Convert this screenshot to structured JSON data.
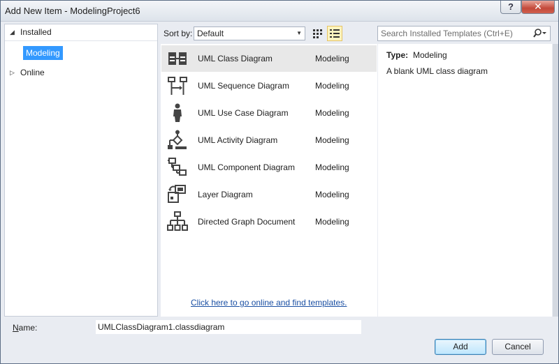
{
  "window": {
    "title": "Add New Item - ModelingProject6",
    "help_label": "?",
    "close_label": "✕"
  },
  "tree": {
    "installed_label": "Installed",
    "selected_child": "Modeling",
    "online_label": "Online"
  },
  "toolbar": {
    "sort_label": "Sort by:",
    "sort_value": "Default",
    "search_placeholder": "Search Installed Templates (Ctrl+E)"
  },
  "templates": [
    {
      "name": "UML Class Diagram",
      "category": "Modeling",
      "icon": "class-diagram-icon"
    },
    {
      "name": "UML Sequence Diagram",
      "category": "Modeling",
      "icon": "sequence-diagram-icon"
    },
    {
      "name": "UML Use Case Diagram",
      "category": "Modeling",
      "icon": "use-case-diagram-icon"
    },
    {
      "name": "UML Activity Diagram",
      "category": "Modeling",
      "icon": "activity-diagram-icon"
    },
    {
      "name": "UML Component Diagram",
      "category": "Modeling",
      "icon": "component-diagram-icon"
    },
    {
      "name": "Layer Diagram",
      "category": "Modeling",
      "icon": "layer-diagram-icon"
    },
    {
      "name": "Directed Graph Document",
      "category": "Modeling",
      "icon": "directed-graph-icon"
    }
  ],
  "online_link": "Click here to go online and find templates.",
  "details": {
    "type_label": "Type:",
    "type_value": "Modeling",
    "description": "A blank UML class diagram"
  },
  "name_field": {
    "label": "Name:",
    "value": "UMLClassDiagram1.classdiagram"
  },
  "buttons": {
    "add_label": "Add",
    "cancel_label": "Cancel"
  }
}
